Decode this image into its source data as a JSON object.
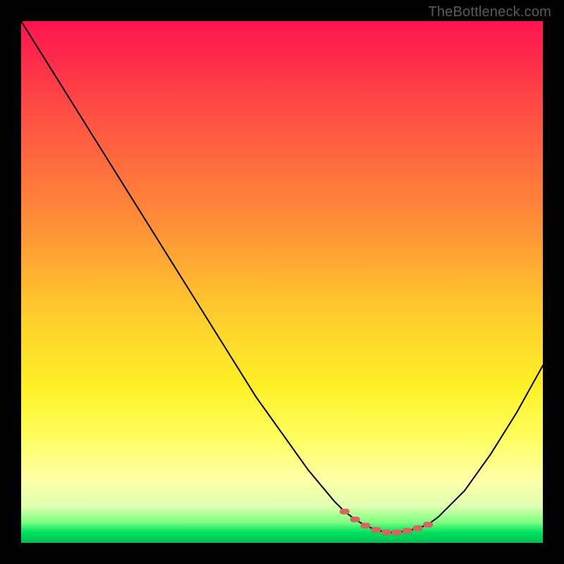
{
  "watermark": "TheBottleneck.com",
  "chart_data": {
    "type": "line",
    "title": "",
    "xlabel": "",
    "ylabel": "",
    "xlim": [
      0,
      100
    ],
    "ylim": [
      0,
      100
    ],
    "series": [
      {
        "name": "bottleneck-curve",
        "x": [
          0,
          5,
          10,
          15,
          20,
          25,
          30,
          35,
          40,
          45,
          50,
          55,
          60,
          62,
          64,
          66,
          68,
          70,
          72,
          74,
          76,
          78,
          80,
          85,
          90,
          95,
          100
        ],
        "y": [
          100,
          92,
          84,
          76,
          68,
          60,
          52,
          44,
          36,
          28,
          21,
          14,
          8,
          6,
          4.5,
          3.3,
          2.5,
          2,
          2,
          2.3,
          2.8,
          3.5,
          5,
          10,
          17,
          25,
          34
        ]
      }
    ],
    "markers": {
      "name": "highlight-region",
      "color": "#d9635e",
      "x": [
        62,
        64,
        66,
        68,
        70,
        72,
        74,
        76,
        78
      ],
      "y": [
        6,
        4.5,
        3.3,
        2.5,
        2,
        2,
        2.3,
        2.8,
        3.5
      ]
    },
    "background": {
      "type": "vertical-gradient",
      "stops": [
        {
          "pos": 0,
          "color": "#ff1450"
        },
        {
          "pos": 0.5,
          "color": "#ffd22c"
        },
        {
          "pos": 0.88,
          "color": "#ffffa8"
        },
        {
          "pos": 1.0,
          "color": "#00c050"
        }
      ]
    }
  }
}
